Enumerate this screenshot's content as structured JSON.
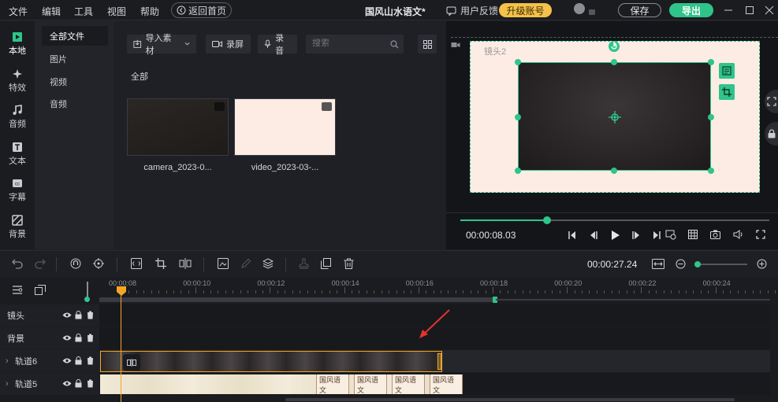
{
  "menu": {
    "items": [
      "文件",
      "编辑",
      "工具",
      "视图",
      "帮助"
    ],
    "home_label": "返回首页"
  },
  "project_title": "国风山水语文*",
  "header": {
    "feedback": "用户反馈",
    "upgrade": "升级账号",
    "save": "保存",
    "export": "导出"
  },
  "rail": [
    "本地",
    "特效",
    "音频",
    "文本",
    "字幕",
    "背景"
  ],
  "categories": [
    "全部文件",
    "图片",
    "视频",
    "音频"
  ],
  "media": {
    "import_label": "导入素材",
    "record_screen": "录屏",
    "record_audio": "录音",
    "search_placeholder": "搜索",
    "section": "全部",
    "items": [
      {
        "label": "camera_2023-0..."
      },
      {
        "label": "video_2023-03-..."
      }
    ]
  },
  "preview": {
    "layer_label": "镜头2",
    "time": "00:00:08.03",
    "progress": 0.28
  },
  "timeline": {
    "duration": "00:00:27.24",
    "ticks": [
      "00:00:08",
      "00:00:10",
      "00:00:12",
      "00:00:14",
      "00:00:16",
      "00:00:18",
      "00:00:20",
      "00:00:22",
      "00:00:24"
    ],
    "tracks": [
      "镜头",
      "背景",
      "轨道6",
      "轨道5"
    ],
    "clip_label": "国风语文"
  },
  "colors": {
    "accent": "#2fc48a",
    "upgrade": "#f5c14a",
    "playhead": "#f5a623",
    "selection": "#f5a623",
    "canvas": "#fdece3"
  }
}
